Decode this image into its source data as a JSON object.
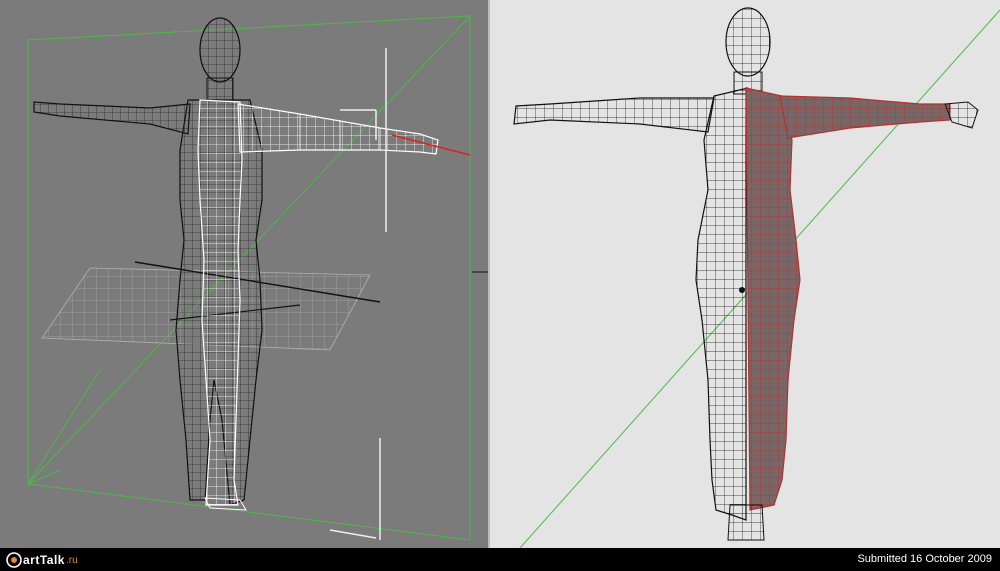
{
  "footer": {
    "logo_text": "artTalk",
    "logo_tld": ".ru",
    "submitted_label": "Submitted",
    "submitted_date": "16 October 2009"
  },
  "viewports": {
    "left": {
      "background": "#7b7b7b",
      "wire_color": "#1a1a1a",
      "selected_wire": "#ffffff",
      "box_color": "#4fb84a"
    },
    "right": {
      "background": "#e4e4e4",
      "wire_color": "#111111",
      "selected_fill": "#7a6666",
      "selected_wire": "#b8302c",
      "line_color": "#4fb84a"
    }
  },
  "colors": {
    "logo_accent": "#e08a2e",
    "gizmo_x": "#e02020"
  }
}
